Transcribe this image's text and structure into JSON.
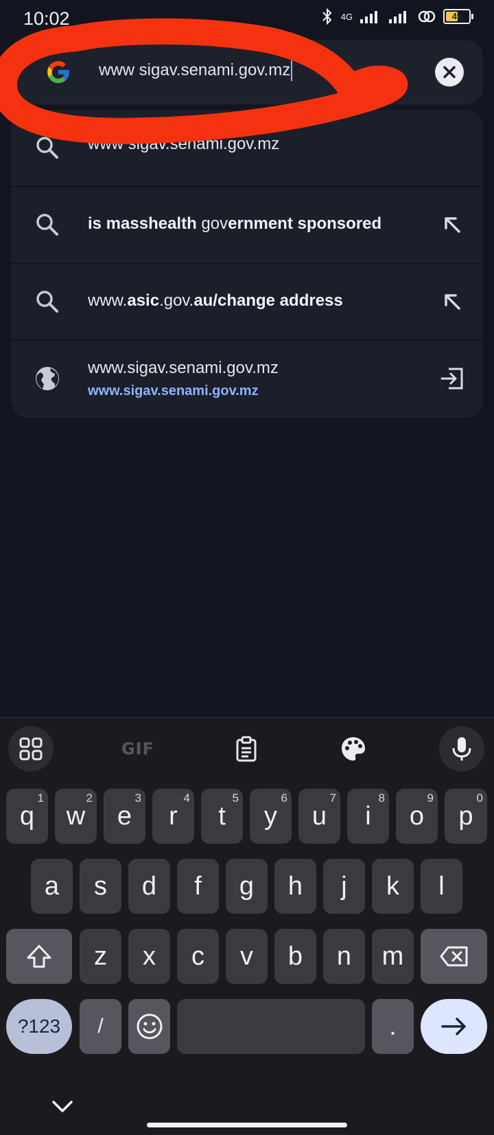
{
  "status_bar": {
    "time": "10:02",
    "network": "4G",
    "battery": "49"
  },
  "search": {
    "query": "www sigav.senami.gov.mz",
    "clear_icon": "close-icon",
    "engine_icon": "google-g-icon"
  },
  "suggestions": [
    {
      "icon": "search-icon",
      "text": "www sigav.senami.gov.mz"
    },
    {
      "icon": "search-icon",
      "parts": [
        {
          "b": true,
          "t": "is masshealth "
        },
        {
          "b": false,
          "t": "gov"
        },
        {
          "b": true,
          "t": "ernment sponsored"
        }
      ],
      "action_icon": "arrow-up-left-icon"
    },
    {
      "icon": "search-icon",
      "parts": [
        {
          "b": false,
          "t": "www."
        },
        {
          "b": true,
          "t": "asic"
        },
        {
          "b": false,
          "t": ".gov."
        },
        {
          "b": true,
          "t": "au/change address"
        }
      ],
      "action_icon": "arrow-up-left-icon"
    },
    {
      "icon": "globe-icon",
      "title": "www.sigav.senami.gov.mz",
      "url": "www.sigav.senami.gov.mz",
      "action_icon": "open-in-icon"
    }
  ],
  "keyboard": {
    "toolbar": {
      "gif": "GIF"
    },
    "row1": [
      {
        "k": "q",
        "h": "1"
      },
      {
        "k": "w",
        "h": "2"
      },
      {
        "k": "e",
        "h": "3"
      },
      {
        "k": "r",
        "h": "4"
      },
      {
        "k": "t",
        "h": "5"
      },
      {
        "k": "y",
        "h": "6"
      },
      {
        "k": "u",
        "h": "7"
      },
      {
        "k": "i",
        "h": "8"
      },
      {
        "k": "o",
        "h": "9"
      },
      {
        "k": "p",
        "h": "0"
      }
    ],
    "row2": [
      "a",
      "s",
      "d",
      "f",
      "g",
      "h",
      "j",
      "k",
      "l"
    ],
    "row3": [
      "z",
      "x",
      "c",
      "v",
      "b",
      "n",
      "m"
    ],
    "symbols": "?123",
    "slash": "/",
    "period": "."
  },
  "colors": {
    "background": "#121520",
    "annotation": "#f5320f",
    "link": "#8fb3ff",
    "enter_key": "#dde5ff"
  }
}
